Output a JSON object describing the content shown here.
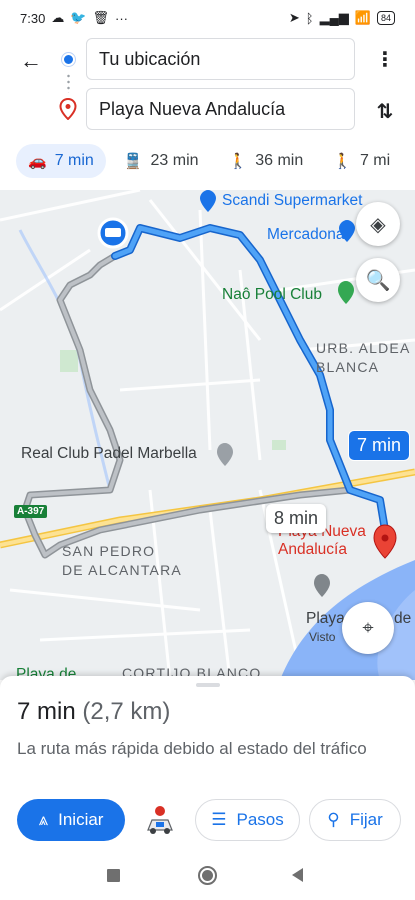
{
  "status_bar": {
    "time": "7:30",
    "left_icons": [
      "cloud-icon",
      "twitter-icon",
      "trash-icon",
      "more-dots-icon"
    ],
    "right_icons": [
      "navigation-icon",
      "bluetooth-icon",
      "signal-icon",
      "wifi-icon"
    ],
    "battery": "84"
  },
  "header": {
    "origin": "Tu ubicación",
    "destination": "Playa Nueva Andalucía"
  },
  "modes": [
    {
      "label": "7 min",
      "icon": "🚗",
      "icon_name": "car-icon",
      "selected": true
    },
    {
      "label": "23 min",
      "icon": "🚆",
      "icon_name": "transit-icon",
      "selected": false
    },
    {
      "label": "36 min",
      "icon": "🚶",
      "icon_name": "walk-icon",
      "selected": false
    },
    {
      "label": "7 mi",
      "icon": "🚶",
      "icon_name": "ride-icon",
      "selected": false
    }
  ],
  "map": {
    "places": {
      "scandi": "Scandi Supermarket",
      "mercadona": "Mercadona",
      "naopool": "Naô Pool Club",
      "urb_line1": "URB. ALDEA",
      "urb_line2": "BLANCA",
      "padel": "Real Club Padel Marbella",
      "sanpedro_line1": "SAN PEDRO",
      "sanpedro_line2": "DE ALCANTARA",
      "destination_line1": "Playa Nueva",
      "destination_line2": "Andalucía",
      "playa_partial": "Playa",
      "playa_partial_right": "de",
      "visto_partial": "Visto",
      "cortijo": "CORTIJO BLANCO",
      "playa_bottom": "Playa de"
    },
    "road_shield": "A-397",
    "route_primary_time": "7 min",
    "route_alt_time": "8 min"
  },
  "sheet": {
    "duration": "7 min",
    "distance": "(2,7 km)",
    "description": "La ruta más rápida debido al estado del tráfico",
    "start_label": "Iniciar",
    "steps_label": "Pasos",
    "pin_label": "Fijar"
  },
  "colors": {
    "accent": "#1a73e8",
    "route_primary": "#1a73e8",
    "route_alt": "#9aa0a6",
    "destination_pin": "#d93025"
  }
}
